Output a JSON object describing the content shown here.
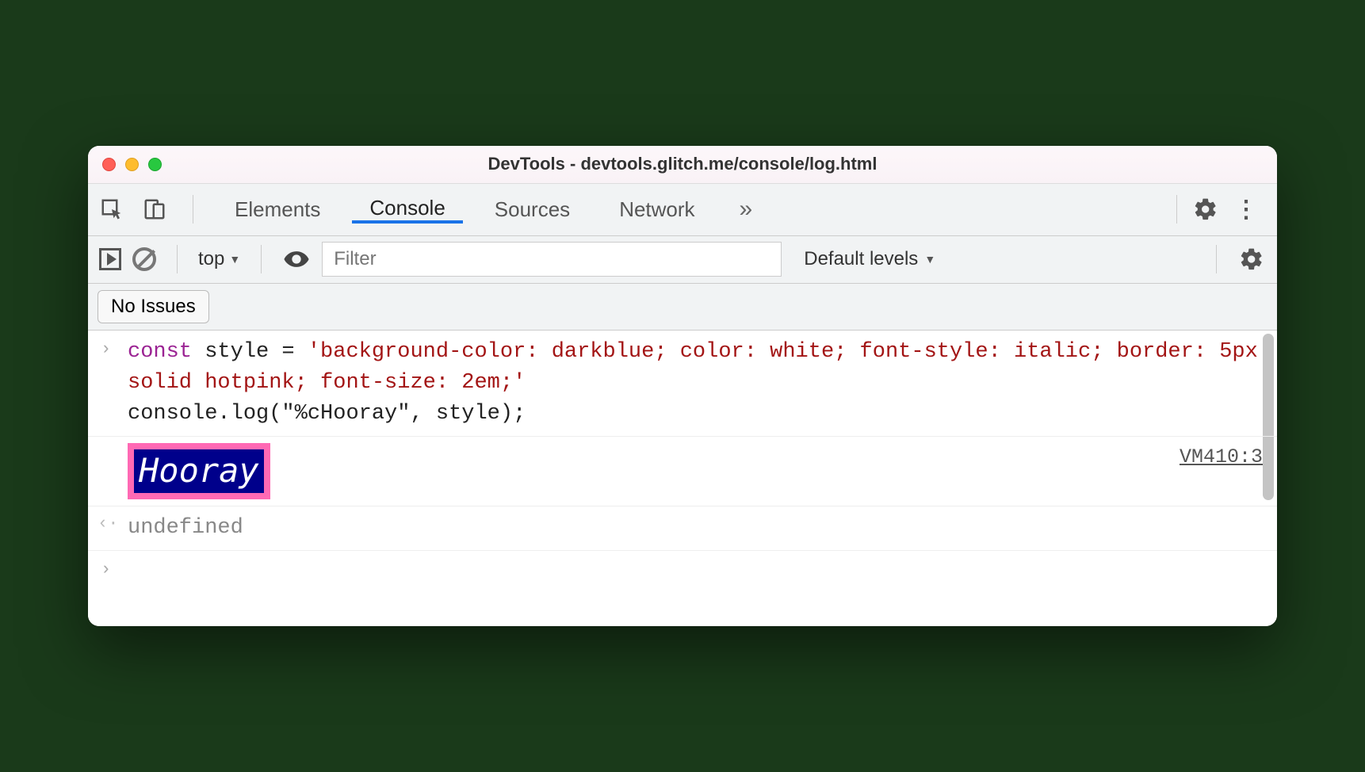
{
  "window": {
    "title": "DevTools - devtools.glitch.me/console/log.html"
  },
  "tabs": {
    "items": [
      "Elements",
      "Console",
      "Sources",
      "Network"
    ],
    "active_index": 1,
    "overflow_glyph": "»"
  },
  "toolbar": {
    "context_label": "top",
    "filter_placeholder": "Filter",
    "levels_label": "Default levels"
  },
  "issues": {
    "button_label": "No Issues"
  },
  "console": {
    "input_gutter": "›",
    "code_line1_kw": "const",
    "code_line1_rest": " style = ",
    "code_line1_str": "'background-color: darkblue; color: white; font-style: italic; border: 5px solid hotpink; font-size: 2em;'",
    "code_blank": "",
    "code_line3": "console.log(\"%cHooray\", style);",
    "styled_output": "Hooray",
    "source_link": "VM410:3",
    "return_gutter": "‹·",
    "return_value": "undefined",
    "prompt_gutter": "›"
  }
}
